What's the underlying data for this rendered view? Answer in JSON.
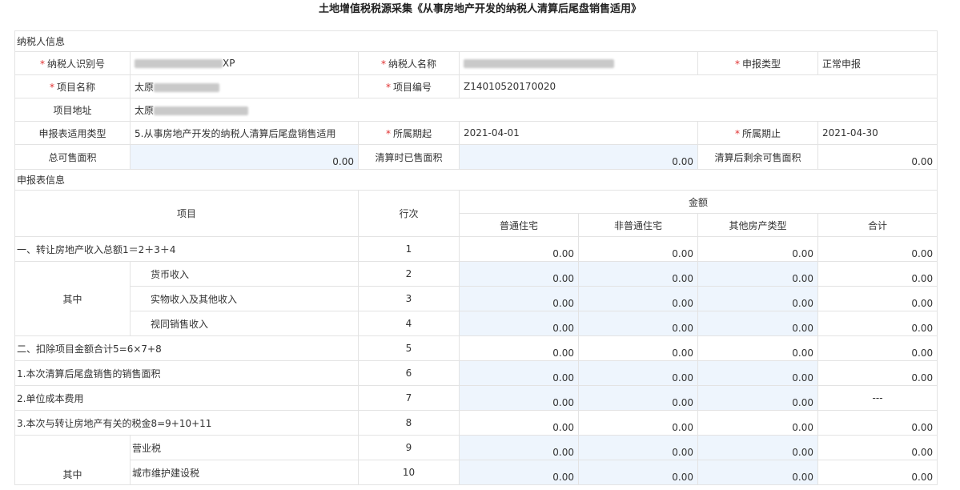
{
  "page": {
    "title": "土地增值税税源采集《从事房地产开发的纳税人清算后尾盘销售适用》"
  },
  "taxpayer": {
    "section": "纳税人信息",
    "labels": {
      "id": "纳税人识别号",
      "name": "纳税人名称",
      "declare_type": "申报类型",
      "project_name": "项目名称",
      "project_no": "项目编号",
      "project_addr": "项目地址",
      "form_type": "申报表适用类型",
      "period_start": "所属期起",
      "period_end": "所属期止",
      "total_area": "总可售面积",
      "sold_area": "清算时已售面积",
      "remain_area": "清算后剩余可售面积"
    },
    "values": {
      "id_visible": "XP",
      "name": "",
      "declare_type": "正常申报",
      "project_name_visible": "太原",
      "project_no": "Z14010520170020",
      "project_addr_visible": "太原",
      "form_type": "5.从事房地产开发的纳税人清算后尾盘销售适用",
      "period_start": "2021-04-01",
      "period_end": "2021-04-30",
      "total_area": "0.00",
      "sold_area": "0.00",
      "remain_area": "0.00"
    }
  },
  "report": {
    "section": "申报表信息",
    "headers": {
      "item": "项目",
      "line": "行次",
      "amount": "金额",
      "cols": [
        "普通住宅",
        "非普通住宅",
        "其他房产类型",
        "合计"
      ]
    },
    "group_label": "其中",
    "rows": [
      {
        "label": "一、转让房地产收入总额1＝2＋3＋4",
        "line": "1",
        "values": [
          "0.00",
          "0.00",
          "0.00",
          "0.00"
        ]
      },
      {
        "label": "货币收入",
        "line": "2",
        "values": [
          "0.00",
          "0.00",
          "0.00",
          "0.00"
        ]
      },
      {
        "label": "实物收入及其他收入",
        "line": "3",
        "values": [
          "0.00",
          "0.00",
          "0.00",
          "0.00"
        ]
      },
      {
        "label": "视同销售收入",
        "line": "4",
        "values": [
          "0.00",
          "0.00",
          "0.00",
          "0.00"
        ]
      },
      {
        "label": "二、扣除项目金额合计5=6×7+8",
        "line": "5",
        "values": [
          "0.00",
          "0.00",
          "0.00",
          "0.00"
        ]
      },
      {
        "label": "1.本次清算后尾盘销售的销售面积",
        "line": "6",
        "values": [
          "0.00",
          "0.00",
          "0.00",
          "0.00"
        ]
      },
      {
        "label": "2.单位成本费用",
        "line": "7",
        "values": [
          "0.00",
          "0.00",
          "0.00",
          "---"
        ]
      },
      {
        "label": "3.本次与转让房地产有关的税金8=9+10+11",
        "line": "8",
        "values": [
          "0.00",
          "0.00",
          "0.00",
          "0.00"
        ]
      },
      {
        "label": "营业税",
        "line": "9",
        "values": [
          "0.00",
          "0.00",
          "0.00",
          "0.00"
        ]
      },
      {
        "label": "城市维护建设税",
        "line": "10",
        "values": [
          "0.00",
          "0.00",
          "0.00",
          "0.00"
        ]
      }
    ]
  }
}
